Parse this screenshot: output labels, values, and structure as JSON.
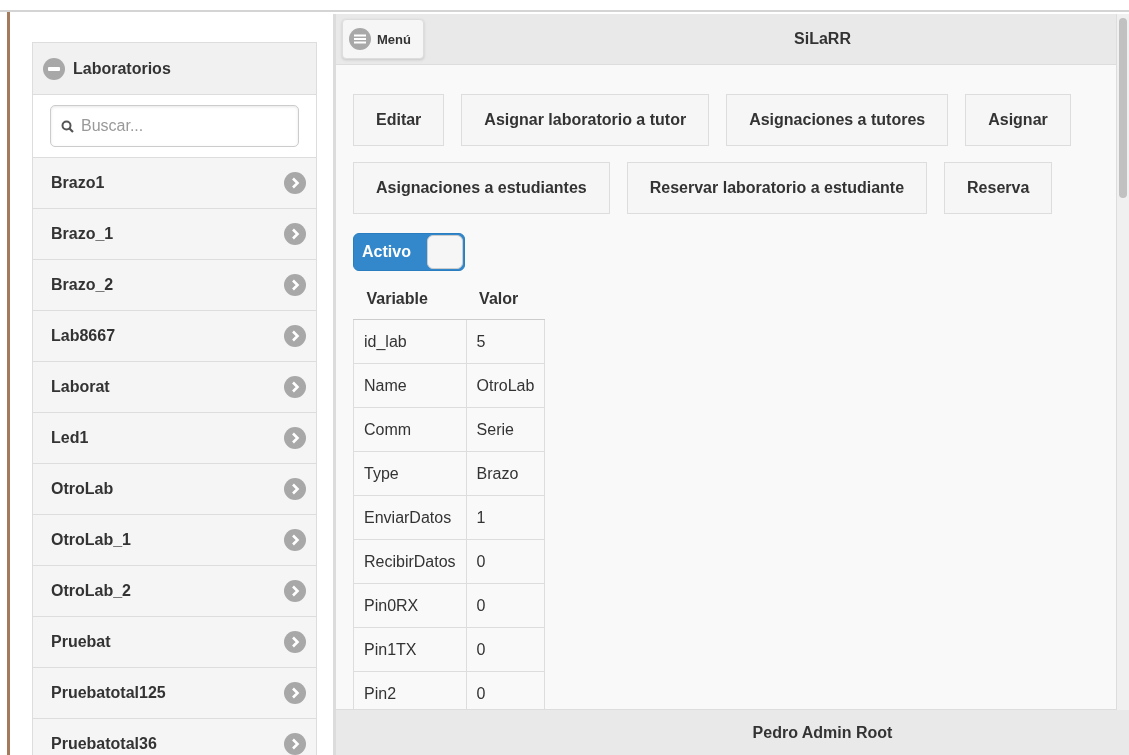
{
  "sidebar": {
    "title": "Laboratorios",
    "expanded": true,
    "search": {
      "placeholder": "Buscar..."
    },
    "items": [
      {
        "label": "Brazo1"
      },
      {
        "label": "Brazo_1"
      },
      {
        "label": "Brazo_2"
      },
      {
        "label": "Lab8667"
      },
      {
        "label": "Laborat"
      },
      {
        "label": "Led1"
      },
      {
        "label": "OtroLab"
      },
      {
        "label": "OtroLab_1"
      },
      {
        "label": "OtroLab_2"
      },
      {
        "label": "Pruebat"
      },
      {
        "label": "Pruebatotal125"
      },
      {
        "label": "Pruebatotal36"
      }
    ]
  },
  "header": {
    "menu_button": "Menú",
    "title": "SiLaRR"
  },
  "action_rows": [
    [
      "Editar",
      "Asignar laboratorio a tutor",
      "Asignaciones a tutores",
      "Asignar"
    ],
    [
      "Asignaciones a estudiantes",
      "Reservar laboratorio a estudiante",
      "Reserva"
    ]
  ],
  "toggle": {
    "label": "Activo",
    "on": true
  },
  "table": {
    "columns": [
      "Variable",
      "Valor"
    ],
    "rows": [
      [
        "id_lab",
        "5"
      ],
      [
        "Name",
        "OtroLab"
      ],
      [
        "Comm",
        "Serie"
      ],
      [
        "Type",
        "Brazo"
      ],
      [
        "EnviarDatos",
        "1"
      ],
      [
        "RecibirDatos",
        "0"
      ],
      [
        "Pin0RX",
        "0"
      ],
      [
        "Pin1TX",
        "0"
      ],
      [
        "Pin2",
        "0"
      ]
    ]
  },
  "footer": {
    "text": "Pedro Admin Root"
  }
}
